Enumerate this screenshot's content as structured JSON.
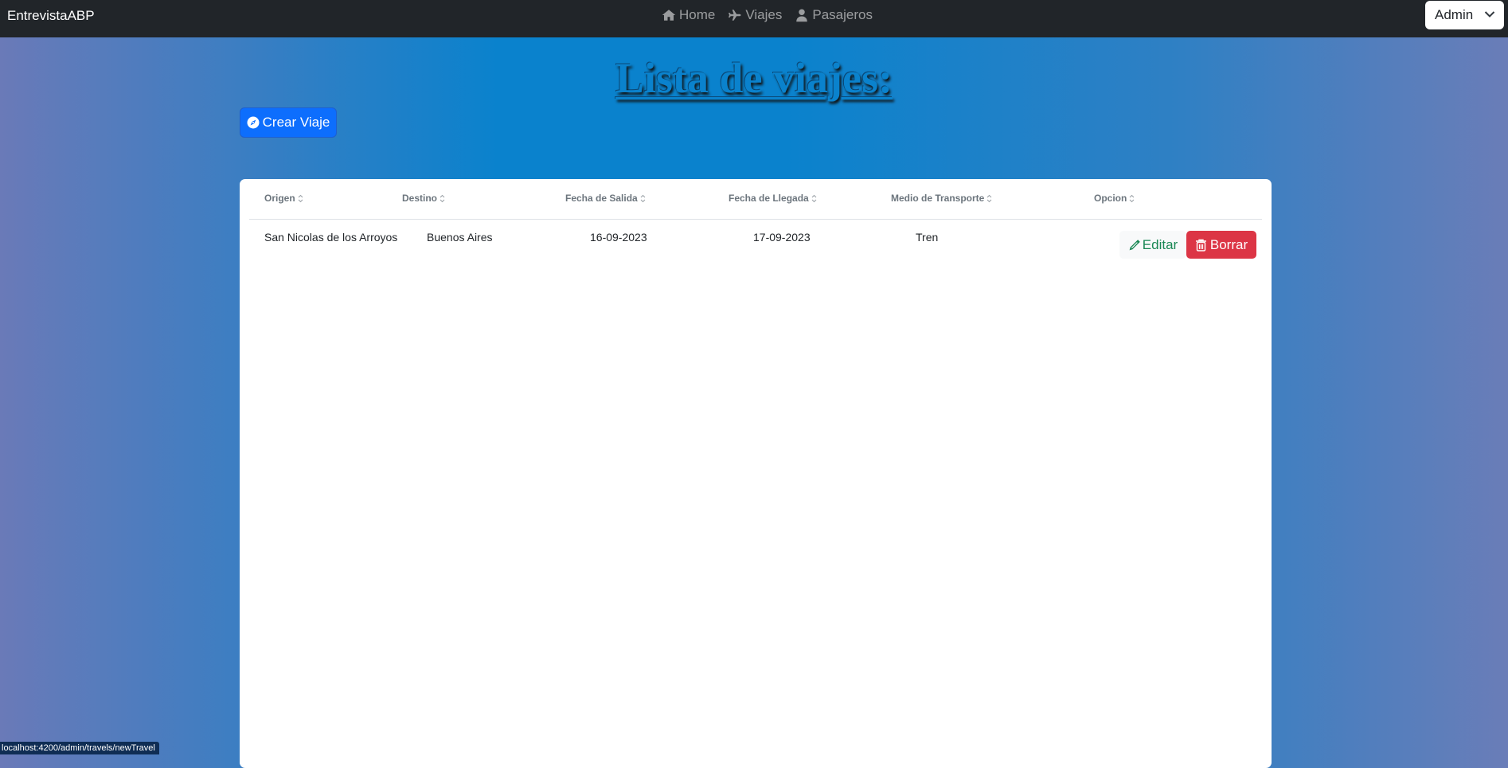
{
  "navbar": {
    "brand": "EntrevistaABP",
    "links": [
      {
        "label": "Home",
        "icon": "home-icon"
      },
      {
        "label": "Viajes",
        "icon": "plane-icon"
      },
      {
        "label": "Pasajeros",
        "icon": "user-icon"
      }
    ],
    "user_select": {
      "value": "Admin",
      "icon": "chevron-down-icon"
    }
  },
  "page": {
    "title": "Lista de viajes:",
    "create_button": {
      "label": "Crear Viaje",
      "icon": "compass-icon"
    }
  },
  "table": {
    "columns": [
      "Origen",
      "Destino",
      "Fecha de Salida",
      "Fecha de Llegada",
      "Medio de Transporte",
      "Opcion"
    ],
    "rows": [
      {
        "origen": "San Nicolas de los Arroyos",
        "destino": "Buenos Aires",
        "fecha_salida": "16-09-2023",
        "fecha_llegada": "17-09-2023",
        "medio": "Tren",
        "actions": {
          "edit": "Editar",
          "delete": "Borrar"
        }
      }
    ]
  },
  "status_bar": {
    "url": "localhost:4200/admin/travels/newTravel"
  },
  "colors": {
    "navbar": "#212529",
    "primary": "#0d6efd",
    "danger": "#dc3545",
    "success": "#198754",
    "title": "#0a82cd"
  }
}
